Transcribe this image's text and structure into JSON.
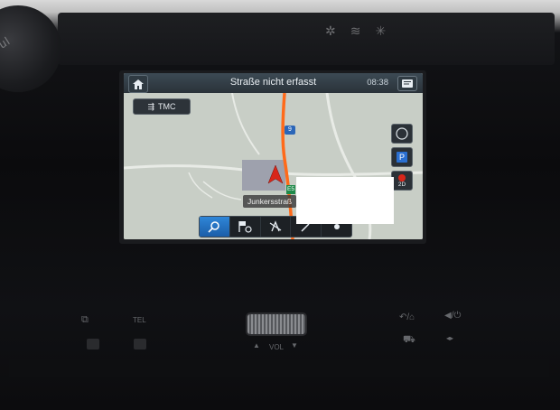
{
  "header": {
    "title": "Straße nicht erfasst",
    "clock": "08:38"
  },
  "left_knob_text": "Luoul",
  "map": {
    "tmc_label": "TMC",
    "route_badge": "9",
    "route_badge_e": "E5",
    "street_label": "Junkersstraß",
    "route_color": "#ff6a1a"
  },
  "side_buttons": [
    "compass-icon",
    "parking-icon",
    "2D"
  ],
  "bottom_bar": {
    "items": [
      "search-icon",
      "destination-flag-icon",
      "route-off-icon",
      "edit-icon",
      "more-icon"
    ],
    "active_color": "#2f86d8"
  },
  "physical_controls": {
    "tel_label": "TEL",
    "vol_label": "VOL",
    "back_label": "↶/⌂",
    "mute_label": "◀/⏻"
  }
}
